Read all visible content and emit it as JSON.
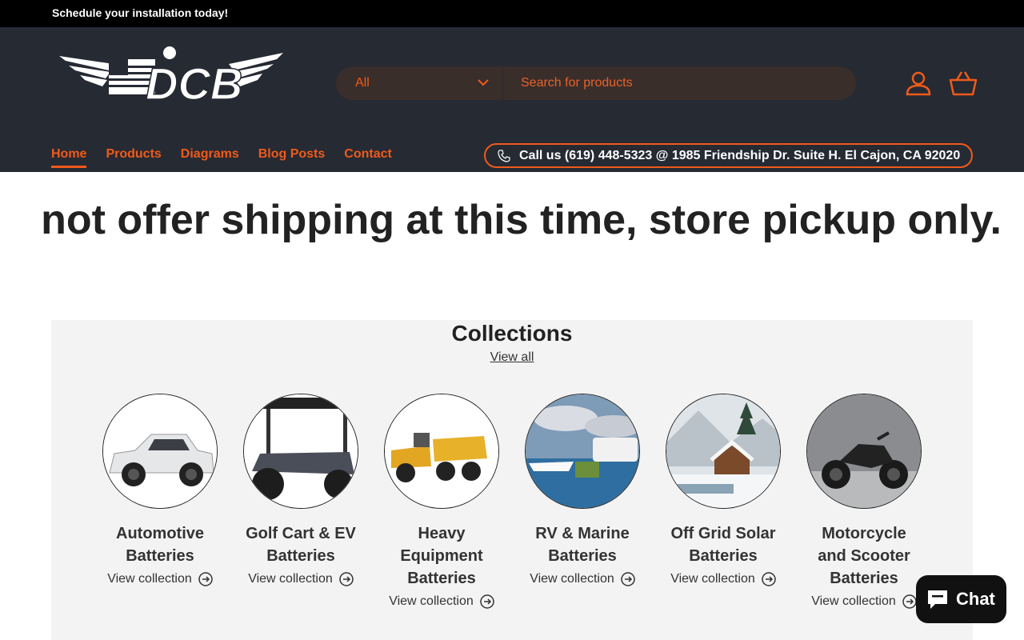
{
  "announcement": {
    "text": "Schedule your installation today!"
  },
  "header": {
    "logo_text": "DCB",
    "search": {
      "category_selected": "All",
      "placeholder": "Search for products"
    },
    "nav": [
      {
        "label": "Home",
        "active": true
      },
      {
        "label": "Products"
      },
      {
        "label": "Diagrams"
      },
      {
        "label": "Blog Posts"
      },
      {
        "label": "Contact"
      }
    ],
    "call_us": "Call us (619) 448-5323 @ 1985 Friendship Dr. Suite H. El Cajon, CA 92020"
  },
  "marquee": {
    "text": "not offer shipping at this time, store pickup only."
  },
  "collections": {
    "heading": "Collections",
    "view_all": "View all",
    "items": [
      {
        "title": "Automotive Batteries",
        "link": "View collection"
      },
      {
        "title": "Golf Cart & EV Batteries",
        "link": "View collection"
      },
      {
        "title": "Heavy Equipment Batteries",
        "link": "View collection"
      },
      {
        "title": "RV & Marine Batteries",
        "link": "View collection"
      },
      {
        "title": "Off Grid Solar Batteries",
        "link": "View collection"
      },
      {
        "title": "Motorcycle and Scooter Batteries",
        "link": "View collection"
      }
    ]
  },
  "chat": {
    "label": "Chat"
  },
  "colors": {
    "accent": "#f05a1a",
    "header_bg": "#262a33",
    "announce_bg": "#000000",
    "section_bg": "#f3f3f3"
  }
}
